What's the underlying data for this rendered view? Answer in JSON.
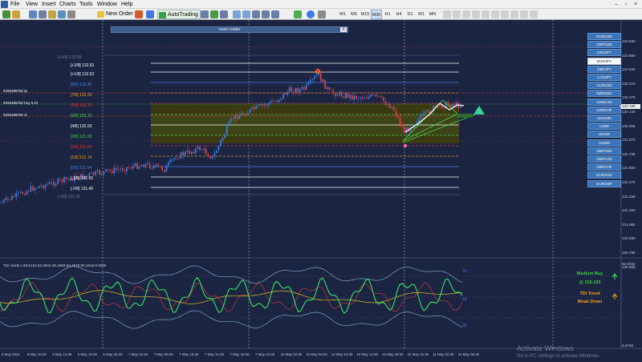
{
  "menubar": {
    "items": [
      "File",
      "View",
      "Insert",
      "Charts",
      "Tools",
      "Window",
      "Help"
    ]
  },
  "toolbar": {
    "new_order": "New Order",
    "auto_trading": "AutoTrading",
    "timeframes": [
      "M1",
      "M5",
      "M15",
      "M30",
      "H1",
      "H4",
      "D1",
      "W1",
      "MN"
    ],
    "active_timeframe": "M30"
  },
  "news_reader": {
    "title": "news reader",
    "close": "X"
  },
  "price_axis": [
    "132.830",
    "132.680",
    "132.545",
    "132.410",
    "132.275",
    "132.140",
    "132.005",
    "131.870",
    "131.735",
    "131.600",
    "131.470",
    "131.335",
    "131.200",
    "131.065",
    "130.930",
    "130.795",
    "130.660"
  ],
  "current_price": "132.199",
  "indicator_axis": [
    "82.8154",
    "70",
    "50",
    "30",
    "9.8756"
  ],
  "fib_levels": [
    {
      "label": "[+3/8] 132.68",
      "color": "#6b7a99"
    },
    {
      "label": "[+2/8]  132.62",
      "color": "#ffffff"
    },
    {
      "label": "[+1/8]  132.52",
      "color": "#ffffff"
    },
    {
      "label": "[8/8]  132.42",
      "color": "#4d7ae0"
    },
    {
      "label": "[7/8]  132.33",
      "color": "#f0a020"
    },
    {
      "label": "[6/8]  132.25",
      "color": "#e83030"
    },
    {
      "label": "[5/8]  132.15",
      "color": "#4bd04b"
    },
    {
      "label": "[4/8]  132.03",
      "color": "#ffffff"
    },
    {
      "label": "[3/8]  131.93",
      "color": "#4bd04b"
    },
    {
      "label": "[2/8]  131.84",
      "color": "#e83030"
    },
    {
      "label": "[1/8]  131.74",
      "color": "#f0a020"
    },
    {
      "label": "[0/8]  131.64",
      "color": "#4d7ae0"
    },
    {
      "label": "[-1/8]  131.55",
      "color": "#ffffff"
    },
    {
      "label": "[-2/8]  131.45",
      "color": "#ffffff"
    },
    {
      "label": "[-3/8] 131.36",
      "color": "#6b7a99"
    }
  ],
  "orders": [
    "#325499792 tp",
    "#325499792 buy 0.01",
    "#325499792 sl"
  ],
  "symbols": [
    "EURUSD",
    "GBPUSD",
    "USDJPY",
    "EURJPY",
    "GBPJPY",
    "CADJPY",
    "AUDUSD",
    "NZDUSD",
    "USDCAD",
    "USDCHF",
    "NAS100",
    "US30",
    "UK100",
    "US500",
    "GBPAUD",
    "GBPCAD",
    "GBPCHF",
    "EURAUD",
    "EURGBP"
  ],
  "selected_symbol": "EURJPY",
  "indicator": {
    "title": "TDI Alerts v 68.5124 52.3942 36.1960 54.2678 50.1518 0.0000",
    "level_70": "70",
    "level_50": "50",
    "level_30": "30",
    "signal": "Medium Buy",
    "signal_price": "@ 132.193",
    "trend_label": "TDI Trend",
    "trend_value": "Weak Down"
  },
  "time_axis": [
    "6 May 2021",
    "6 May 10:30",
    "6 May 14:30",
    "6 May 18:30",
    "6 May 22:30",
    "7 May 02:30",
    "7 May 06:30",
    "7 May 10:30",
    "7 May 14:30",
    "7 May 18:30",
    "7 May 22:30",
    "10 May 02:30",
    "10 May 06:30",
    "10 May 10:30",
    "10 May 14:30",
    "10 May 18:30",
    "10 May 22:30",
    "11 May 02:30",
    "11 May 06:30"
  ],
  "watermark": {
    "line1": "Activate Windows",
    "line2": "Go to PC settings to activate Windows."
  },
  "colors": {
    "background": "#1b2542",
    "bull": "#3d7be0",
    "bear": "#e03a3a",
    "fib_zone": "#3a3a12",
    "tdi_green": "#3cf06a",
    "tdi_signal": "#e0c020"
  }
}
